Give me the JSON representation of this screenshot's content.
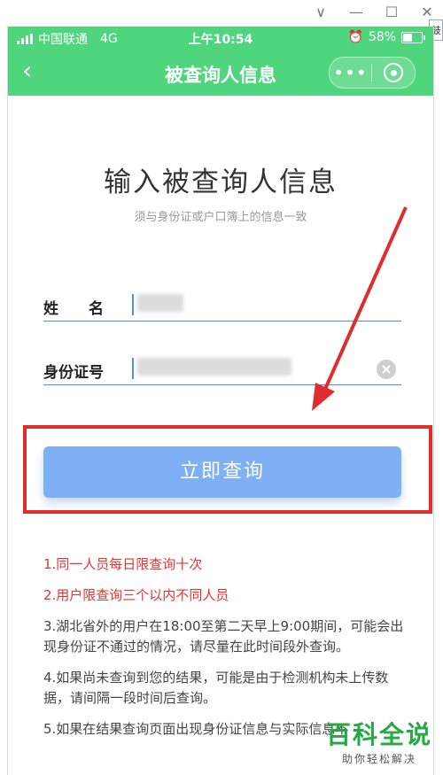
{
  "window": {
    "controls": [
      "∨",
      "—",
      "☐",
      "✕"
    ],
    "edge_tab": "鼓"
  },
  "status_bar": {
    "carrier": "中国联通",
    "network": "4G",
    "time": "上午10:54",
    "battery": "58%",
    "battery_level": 0.58
  },
  "nav": {
    "title": "被查询人信息",
    "more_label": "•••"
  },
  "form": {
    "heading": "输入被查询人信息",
    "subheading": "须与身份证或户口簿上的信息一致",
    "name_label": "姓　　名",
    "id_label": "身份证号",
    "name_value": "",
    "id_value": ""
  },
  "query_button": "立即查询",
  "notes": [
    {
      "text": "1.同一人员每日限查询十次",
      "color": "#e8332e"
    },
    {
      "text": "2.用户限查询三个以内不同人员",
      "color": "#e8332e"
    },
    {
      "text": "3.湖北省外的用户在18:00至第二天早上9:00期间，可能会出现身份证不通过的情况，请尽量在此时间段外查询。",
      "color": "#444444"
    },
    {
      "text": "4.如果尚未查询到您的结果，可能是由于检测机构未上传数据，请间隔一段时间后查询。",
      "color": "#444444"
    },
    {
      "text": "5.如果在结果查询页面出现身份证信息与实际信息不",
      "color": "#444444"
    }
  ],
  "watermark": {
    "main": "百科全说",
    "sub": "助你轻松解决"
  },
  "colors": {
    "brand_green": "#4fd57e",
    "button_blue": "#7fb0f4",
    "annotation_red": "#e02c2c"
  }
}
